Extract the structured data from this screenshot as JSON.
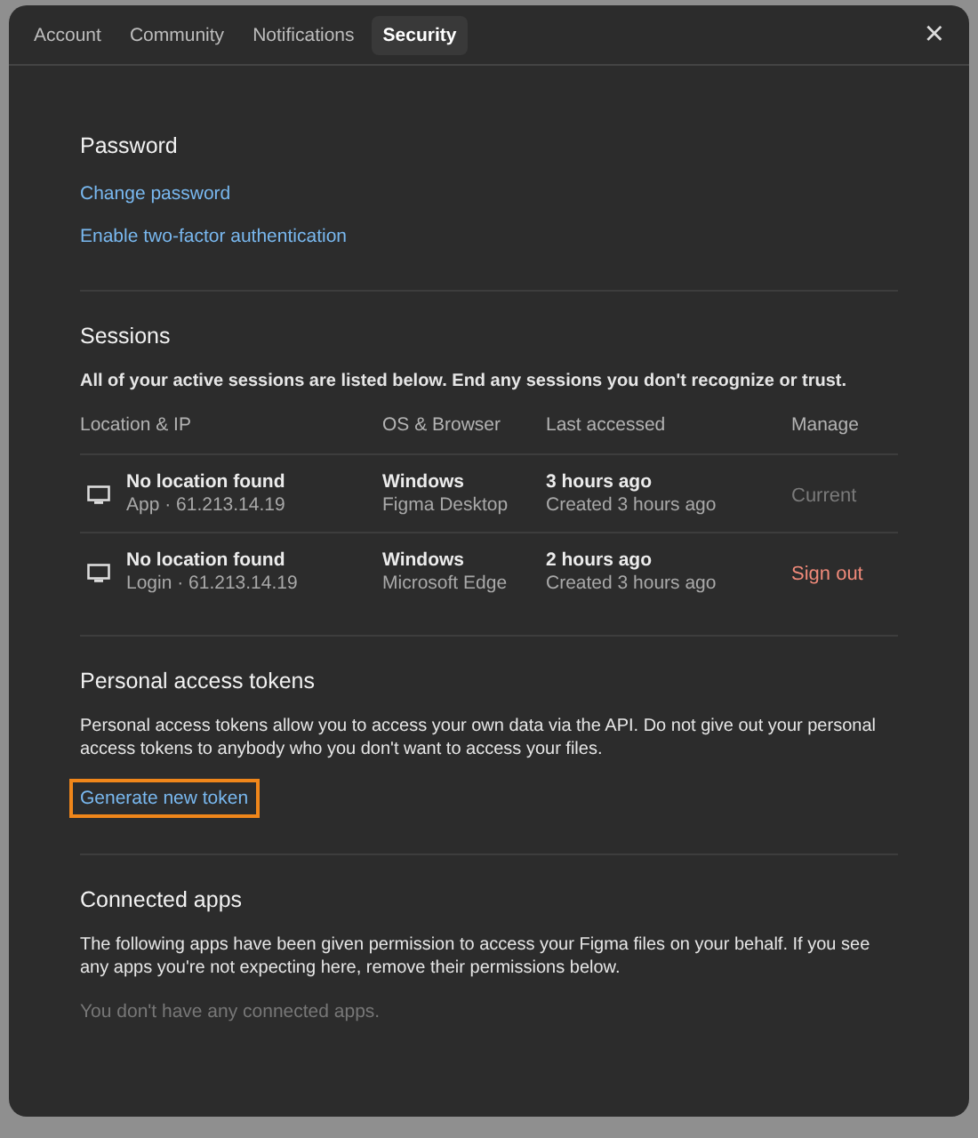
{
  "tabs": [
    {
      "label": "Account",
      "selected": false
    },
    {
      "label": "Community",
      "selected": false
    },
    {
      "label": "Notifications",
      "selected": false
    },
    {
      "label": "Security",
      "selected": true
    }
  ],
  "close": "×",
  "password": {
    "title": "Password",
    "links": [
      {
        "label": "Change password",
        "focused": false
      },
      {
        "label": "Enable two-factor authentication",
        "focused": false
      }
    ]
  },
  "sessions": {
    "title": "Sessions",
    "description": "All of your active sessions are listed below. End any sessions you don't recognize or trust.",
    "columns": [
      "Location & IP",
      "OS & Browser",
      "Last accessed",
      "Manage"
    ],
    "rows": [
      {
        "location": "No location found",
        "ip": "App · 61.213.14.19",
        "os": "Windows",
        "browser": "Figma Desktop",
        "last": "3 hours ago",
        "created": "Created 3 hours ago",
        "manage": {
          "kind": "status",
          "label": "Current"
        }
      },
      {
        "location": "No location found",
        "ip": "Login · 61.213.14.19",
        "os": "Windows",
        "browser": "Microsoft Edge",
        "last": "2 hours ago",
        "created": "Created 3 hours ago",
        "manage": {
          "kind": "action",
          "label": "Sign out"
        }
      }
    ]
  },
  "tokens": {
    "title": "Personal access tokens",
    "description": "Personal access tokens allow you to access your own data via the API. Do not give out your personal access tokens to anybody who you don't want to access your files.",
    "link": {
      "label": "Generate new token",
      "focused": true
    }
  },
  "apps": {
    "title": "Connected apps",
    "description": "The following apps have been given permission to access your Figma files on your behalf. If you see any apps you're not expecting here, remove their permissions below.",
    "empty": "You don't have any connected apps."
  }
}
